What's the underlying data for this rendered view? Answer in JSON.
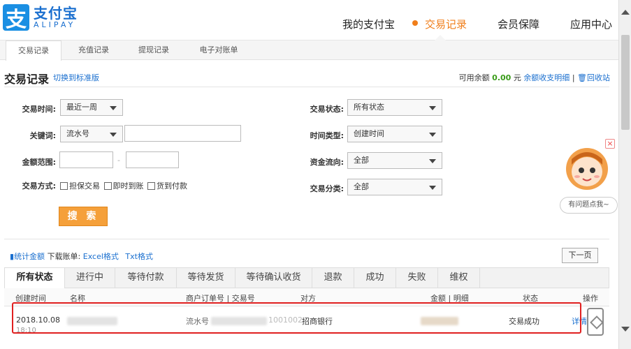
{
  "header": {
    "logo_cn": "支付宝",
    "logo_en": "ALIPAY",
    "logo_mark": "支",
    "nav": [
      "我的支付宝",
      "交易记录",
      "会员保障",
      "应用中心"
    ]
  },
  "subnav": [
    "交易记录",
    "充值记录",
    "提现记录",
    "电子对账单"
  ],
  "page": {
    "title": "交易记录",
    "switch_link": "切换到标准版",
    "balance_label": "可用余额",
    "balance_amount": "0.00",
    "balance_unit": "元",
    "balance_detail_link": "余额收支明细",
    "separator": "|",
    "recycle_link": "回收站"
  },
  "filters": {
    "time_label": "交易时间:",
    "time_value": "最近一周",
    "keyword_label": "关键词:",
    "keyword_type": "流水号",
    "amount_label": "金额范围:",
    "amount_sep": "-",
    "method_label": "交易方式:",
    "method_options": [
      "担保交易",
      "即时到账",
      "货到付款"
    ],
    "status_label": "交易状态:",
    "status_value": "所有状态",
    "timetype_label": "时间类型:",
    "timetype_value": "创建时间",
    "flow_label": "资金流向:",
    "flow_value": "全部",
    "category_label": "交易分类:",
    "category_value": "全部",
    "search_button": "搜 索"
  },
  "stats": {
    "stat_link": "统计金额",
    "download_label": "下载账单:",
    "excel_link": "Excel格式",
    "txt_link": "Txt格式",
    "next_page": "下一页"
  },
  "tabs": [
    "所有状态",
    "进行中",
    "等待付款",
    "等待发货",
    "等待确认收货",
    "退款",
    "成功",
    "失败",
    "维权"
  ],
  "table": {
    "headers": [
      "创建时间",
      "名称",
      "商户订单号 | 交易号",
      "对方",
      "金额 | 明细",
      "状态",
      "操作"
    ],
    "rows": [
      {
        "date": "2018.10.08",
        "time": "18:10",
        "order": "流水号",
        "order_tail": "1001002",
        "party": "招商银行",
        "status": "交易成功",
        "action": "详情"
      }
    ]
  },
  "helper": {
    "close": "×",
    "bubble": "有问题点我~"
  },
  "colors": {
    "accent": "#f07e1a",
    "link": "#1a6fcf",
    "highlight": "#e02020",
    "money": "#3a9c1a"
  }
}
